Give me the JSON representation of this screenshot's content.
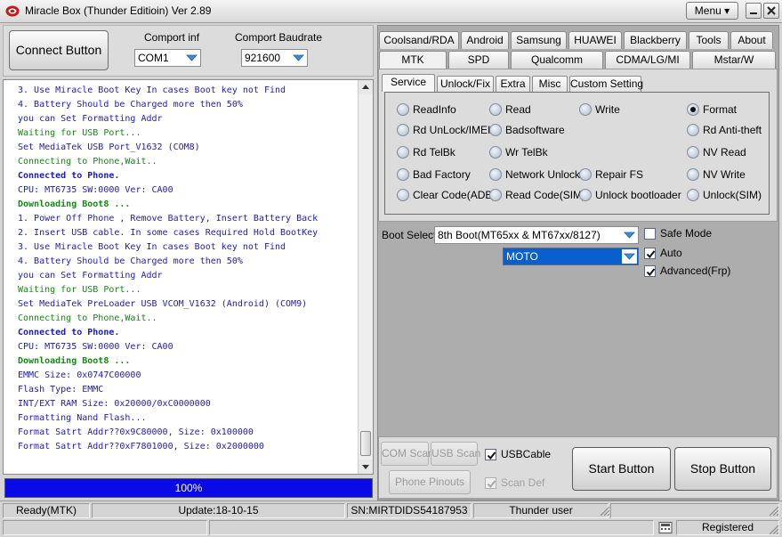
{
  "window": {
    "title": "Miracle Box (Thunder Editioin) Ver 2.89",
    "menu_label": "Menu"
  },
  "connect": {
    "button_label": "Connect Button",
    "comport_label": "Comport inf",
    "comport_value": "COM1",
    "baud_label": "Comport Baudrate",
    "baud_value": "921600"
  },
  "log": [
    {
      "text": "3. Use Miracle Boot Key In cases Boot key not Find",
      "color": "blue",
      "bold": false
    },
    {
      "text": "4. Battery Should be Charged more then 50%",
      "color": "blue",
      "bold": false
    },
    {
      "text": "you can Set Formatting Addr",
      "color": "blue",
      "bold": false
    },
    {
      "text": "Waiting for USB Port...",
      "color": "green",
      "bold": false
    },
    {
      "text": "Set MediaTek USB Port_V1632 (COM8)",
      "color": "blue",
      "bold": false
    },
    {
      "text": "Connecting to Phone,Wait..",
      "color": "green",
      "bold": false
    },
    {
      "text": "Connected to Phone.",
      "color": "blue",
      "bold": true
    },
    {
      "text": "CPU: MT6735 SW:0000 Ver: CA00",
      "color": "blue",
      "bold": false
    },
    {
      "text": "Downloading Boot8 ...",
      "color": "green",
      "bold": true
    },
    {
      "text": "1. Power Off Phone , Remove Battery, Insert Battery Back",
      "color": "blue",
      "bold": false
    },
    {
      "text": "2. Insert USB cable. In some cases Required Hold BootKey",
      "color": "blue",
      "bold": false
    },
    {
      "text": "3. Use Miracle Boot Key In cases Boot key not Find",
      "color": "blue",
      "bold": false
    },
    {
      "text": "4. Battery Should be Charged more then 50%",
      "color": "blue",
      "bold": false
    },
    {
      "text": "you can Set Formatting Addr",
      "color": "blue",
      "bold": false
    },
    {
      "text": "Waiting for USB Port...",
      "color": "green",
      "bold": false
    },
    {
      "text": "Set MediaTek PreLoader USB VCOM_V1632 (Android) (COM9)",
      "color": "blue",
      "bold": false
    },
    {
      "text": "Connecting to Phone,Wait..",
      "color": "green",
      "bold": false
    },
    {
      "text": "Connected to Phone.",
      "color": "blue",
      "bold": true
    },
    {
      "text": "CPU: MT6735 SW:0000 Ver: CA00",
      "color": "blue",
      "bold": false
    },
    {
      "text": "Downloading Boot8 ...",
      "color": "green",
      "bold": true
    },
    {
      "text": "EMMC Size: 0x0747C00000",
      "color": "blue",
      "bold": false
    },
    {
      "text": "Flash Type: EMMC",
      "color": "blue",
      "bold": false
    },
    {
      "text": "INT/EXT RAM  Size: 0x20000/0xC0000000",
      "color": "blue",
      "bold": false
    },
    {
      "text": "Formatting Nand Flash...",
      "color": "blue",
      "bold": false
    },
    {
      "text": "Format Satrt Addr??0x9C80000, Size: 0x100000",
      "color": "blue",
      "bold": false
    },
    {
      "text": "Format Satrt Addr??0xF7801000, Size: 0x2000000",
      "color": "blue",
      "bold": false
    }
  ],
  "progress": {
    "label": "100%",
    "value": 1.0
  },
  "tabs_row1": [
    "Coolsand/RDA",
    "Android",
    "Samsung",
    "HUAWEI",
    "Blackberry",
    "Tools",
    "About"
  ],
  "tabs_row2": [
    "MTK",
    "SPD",
    "Qualcomm",
    "CDMA/LG/MI",
    "Mstar/W"
  ],
  "active_tab": "MTK",
  "subtabs": [
    "Service",
    "Unlock/Fix",
    "Extra",
    "Misc",
    "Custom Setting"
  ],
  "active_subtab": "Service",
  "options": [
    {
      "label": "ReadInfo",
      "selected": false
    },
    {
      "label": "Read",
      "selected": false
    },
    {
      "label": "Write",
      "selected": false
    },
    {
      "label": "Format",
      "selected": true
    },
    {
      "label": "Rd UnLock/IMEI",
      "selected": false
    },
    {
      "label": "Badsoftware",
      "selected": false
    },
    {
      "label": "Rd Anti-theft",
      "selected": false
    },
    {
      "label": "Rd TelBk",
      "selected": false
    },
    {
      "label": "Wr TelBk",
      "selected": false
    },
    {
      "label": "NV Read",
      "selected": false
    },
    {
      "label": "Bad Factory",
      "selected": false
    },
    {
      "label": "Network Unlock",
      "selected": false
    },
    {
      "label": "Repair FS",
      "selected": false
    },
    {
      "label": "NV Write",
      "selected": false
    },
    {
      "label": "Clear Code(ADB)",
      "selected": false
    },
    {
      "label": "Read Code(SIM)",
      "selected": false
    },
    {
      "label": "Unlock bootloader",
      "selected": false
    },
    {
      "label": "Unlock(SIM)",
      "selected": false
    }
  ],
  "boot": {
    "label": "Boot Select:",
    "value": "8th Boot(MT65xx & MT67xx/8127)",
    "model_value": "MOTO"
  },
  "checks": [
    {
      "label": "Safe Mode",
      "checked": false
    },
    {
      "label": "Auto",
      "checked": true
    },
    {
      "label": "Advanced(Frp)",
      "checked": true
    }
  ],
  "bottom": {
    "com_scan": "COM Scan",
    "usb_scan": "USB Scan",
    "usb_cable": "USBCable",
    "usb_cable_checked": true,
    "phone_pinouts": "Phone Pinouts",
    "scan_def": "Scan Def",
    "scan_def_checked": true,
    "start": "Start Button",
    "stop": "Stop Button"
  },
  "status": {
    "mode": "Ready(MTK)",
    "update": "Update:18-10-15",
    "sn": "SN:MIRTDIDS54187953",
    "user": "Thunder user",
    "registered": "Registered"
  },
  "colors": {
    "log_blue": "#1a1ac8",
    "log_green": "#118a11",
    "progress": "#0a0ae6",
    "panel": "#adadad"
  }
}
